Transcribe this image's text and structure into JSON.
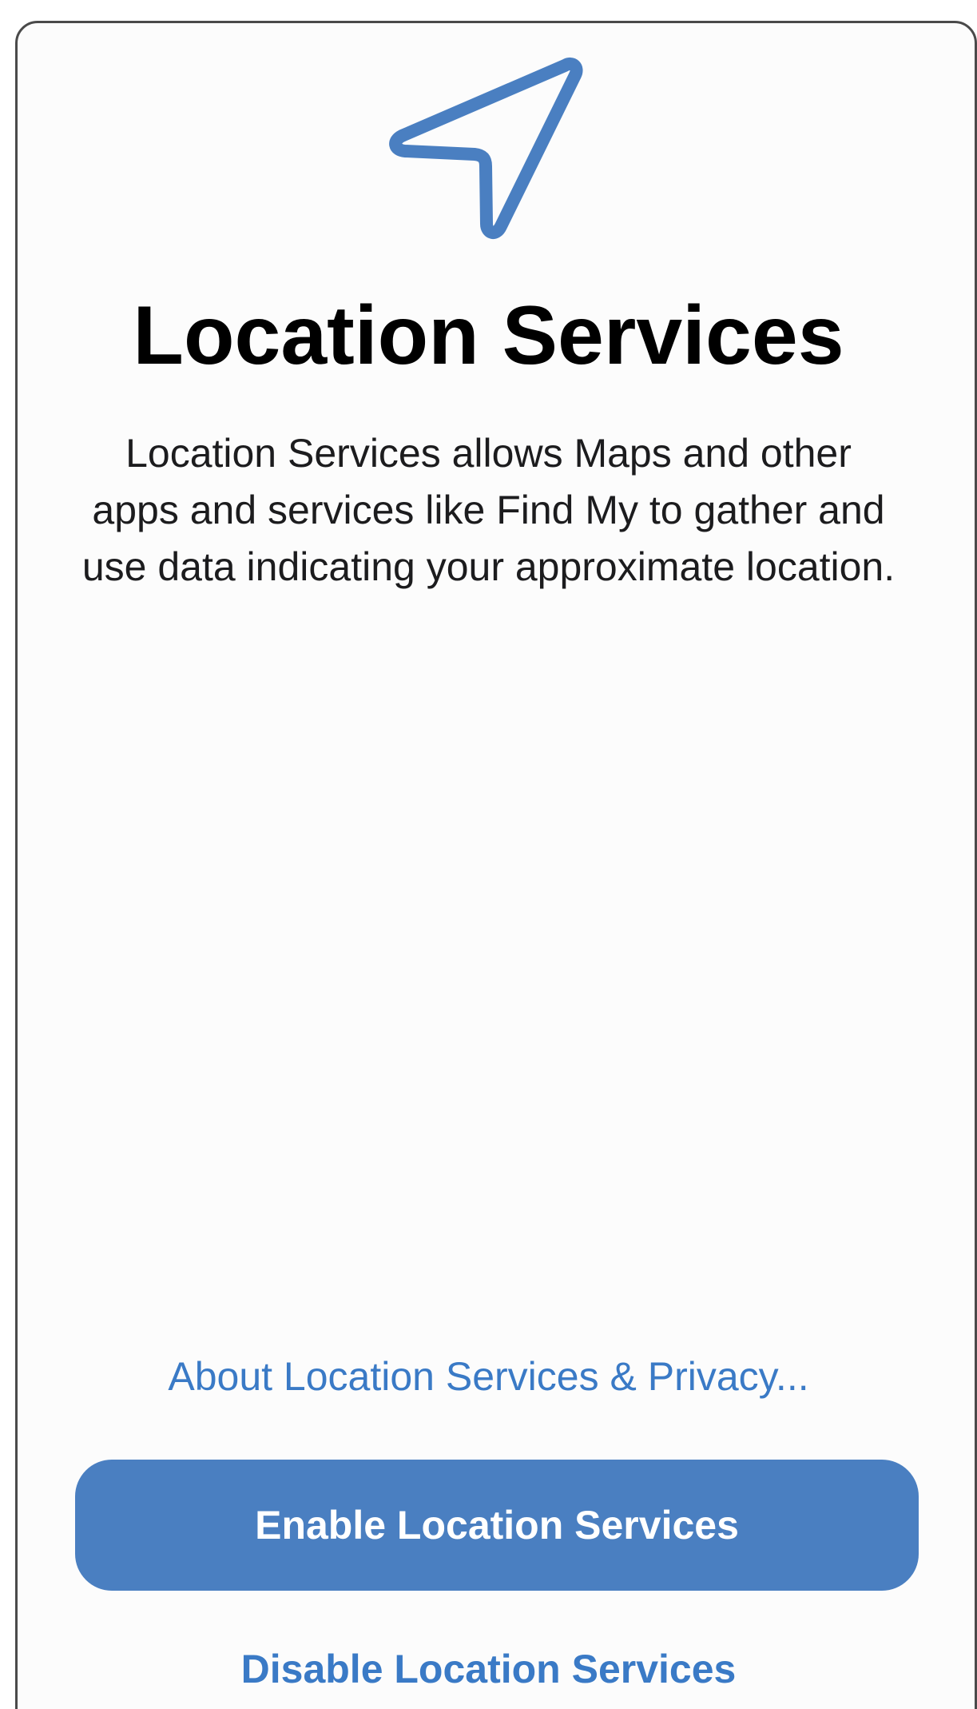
{
  "header": {
    "icon": "location-arrow-icon",
    "title": "Location Services"
  },
  "body": {
    "description": "Location Services allows Maps and other apps and services like Find My to gather and use data indicating your approximate location."
  },
  "actions": {
    "about_link": "About Location Services & Privacy...",
    "enable_label": "Enable Location Services",
    "disable_label": "Disable Location Services"
  },
  "colors": {
    "accent": "#4a7fc1",
    "link": "#3a7ac6",
    "icon_stroke": "#4a7fc1"
  }
}
